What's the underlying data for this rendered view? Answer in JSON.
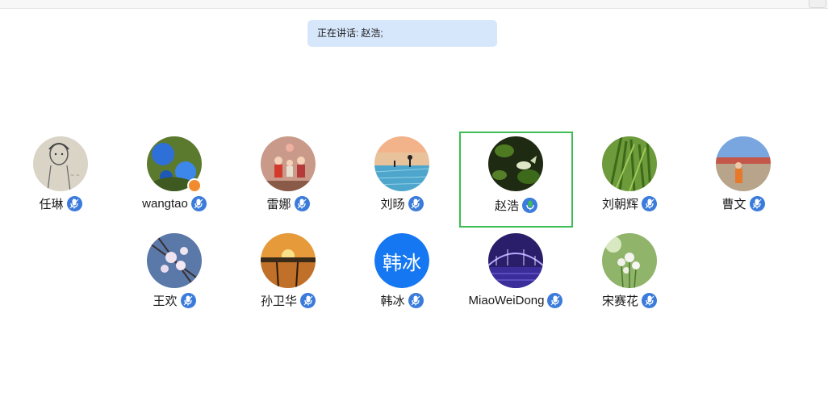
{
  "speaking_banner": {
    "label": "正在讲话:",
    "names": "赵浩;"
  },
  "participants": [
    {
      "name": "任琳"
    },
    {
      "name": "wangtao"
    },
    {
      "name": "雷娜"
    },
    {
      "name": "刘旸"
    },
    {
      "name": "赵浩"
    },
    {
      "name": "刘朝辉"
    },
    {
      "name": "曹文"
    },
    {
      "name": "王欢"
    },
    {
      "name": "孙卫华"
    },
    {
      "name": "韩冰",
      "avatar_text": "韩冰"
    },
    {
      "name": "MiaoWeiDong"
    },
    {
      "name": "宋赛花"
    }
  ],
  "colors": {
    "mic_icon": "#3a7bdb",
    "mic_speaking": "#3fbd54",
    "active_speaker_border": "#3fbd54",
    "text_avatar_bg": "#1577f2",
    "host_badge": "#f28a2e"
  }
}
